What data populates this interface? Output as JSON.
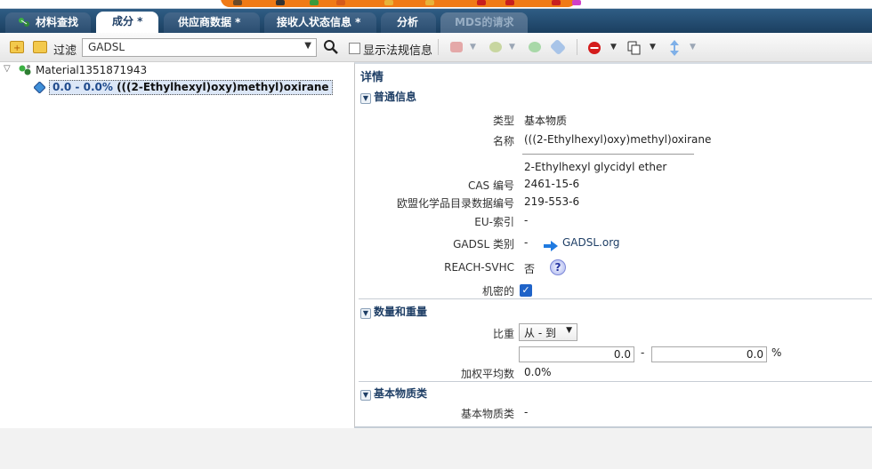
{
  "tabs": [
    {
      "label": "材料查找"
    },
    {
      "label": "成分 *"
    },
    {
      "label": "供应商数据 *"
    },
    {
      "label": "接收人状态信息 *"
    },
    {
      "label": "分析"
    },
    {
      "label": "MDS的请求"
    }
  ],
  "toolbar": {
    "filter_label": "过滤",
    "filter_value": "GADSL",
    "show_reg_label": "显示法规信息"
  },
  "tree": {
    "root_label": "Material1351871943",
    "child_range": "0.0 - 0.0%",
    "child_name": "(((2-Ethylhexyl)oxy)methyl)oxirane"
  },
  "details": {
    "title": "详情",
    "general": {
      "header": "普通信息",
      "type_label": "类型",
      "type_value": "基本物质",
      "name_label": "名称",
      "name_value": "(((2-Ethylhexyl)oxy)methyl)oxirane",
      "synonym": "2-Ethylhexyl glycidyl ether",
      "cas_label": "CAS 编号",
      "cas_value": "2461-15-6",
      "eu_label": "欧盟化学品目录数据编号",
      "eu_value": "219-553-6",
      "eu_index_label": "EU-索引",
      "eu_index_value": "-",
      "gadsl_label": "GADSL 类别",
      "gadsl_value": "-",
      "gadsl_link": "GADSL.org",
      "reach_label": "REACH-SVHC",
      "reach_value": "否",
      "confidential_label": "机密的"
    },
    "quantity": {
      "header": "数量和重量",
      "ratio_label": "比重",
      "ratio_select": "从 - 到",
      "from_value": "0.0",
      "range_dash": "-",
      "to_value": "0.0",
      "unit": "%",
      "weighted_label": "加权平均数",
      "weighted_value": "0.0%"
    },
    "basic": {
      "header": "基本物质类",
      "label": "基本物质类",
      "value": "-"
    }
  },
  "colors": {
    "tabbar": "#1b3f60",
    "accent": "#1f3f66",
    "highlight": "#dce7f7",
    "orange": "#f07a16"
  }
}
